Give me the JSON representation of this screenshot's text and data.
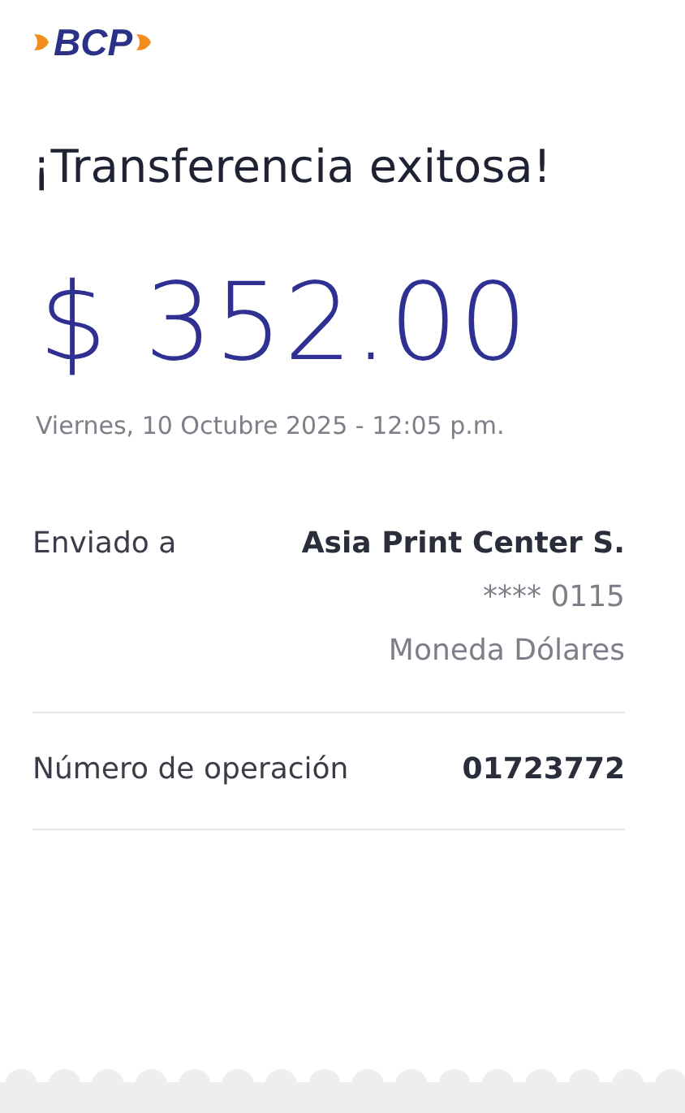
{
  "logo": {
    "text": "BCP"
  },
  "title": "¡Transferencia exitosa!",
  "amount": "$ 352.00",
  "date": "Viernes, 10 Octubre 2025 - 12:05 p.m.",
  "sent_to": {
    "label": "Enviado a",
    "name": "Asia Print Center S.",
    "account": "**** 0115",
    "currency": "Moneda Dólares"
  },
  "operation": {
    "label": "Número de operación",
    "number": "01723772"
  }
}
